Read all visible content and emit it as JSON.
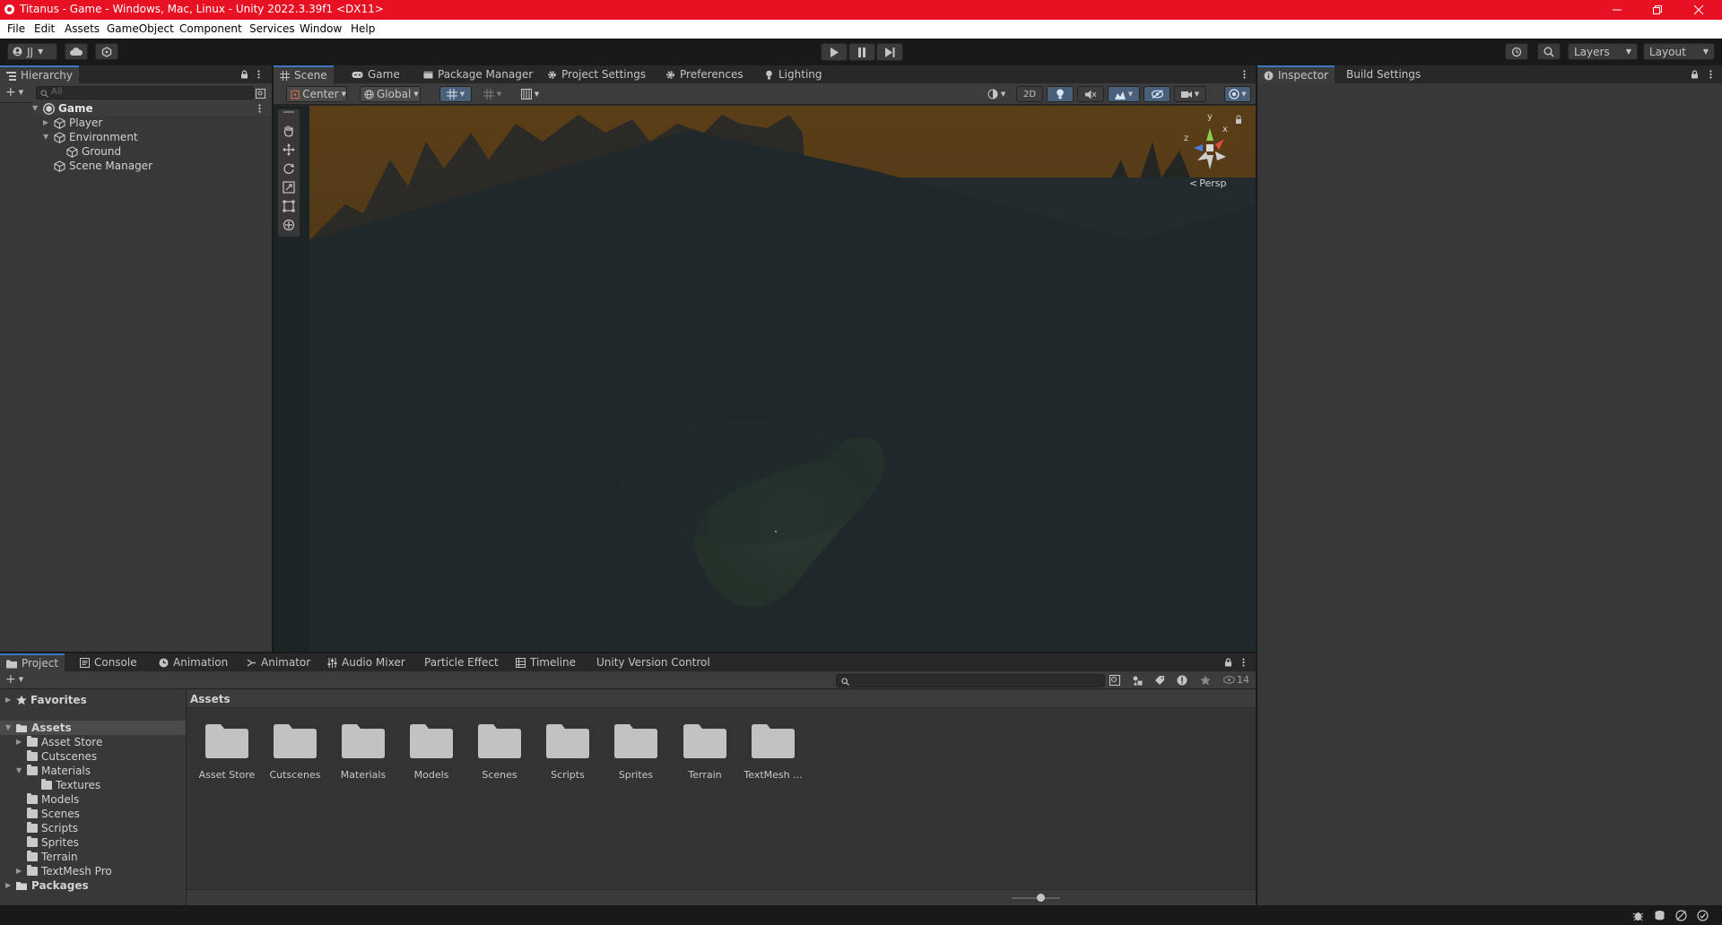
{
  "window": {
    "title": "Titanus - Game - Windows, Mac, Linux - Unity 2022.3.39f1 <DX11>"
  },
  "menu": [
    "File",
    "Edit",
    "Assets",
    "GameObject",
    "Component",
    "Services",
    "Window",
    "Help"
  ],
  "toolbar": {
    "account_label": "JJ",
    "layers_label": "Layers",
    "layout_label": "Layout"
  },
  "hierarchy": {
    "tab_label": "Hierarchy",
    "search_placeholder": "All",
    "scene_name": "Game",
    "items": [
      {
        "label": "Player"
      },
      {
        "label": "Environment"
      },
      {
        "label": "Ground"
      },
      {
        "label": "Scene Manager"
      }
    ]
  },
  "center_tabs": [
    "Scene",
    "Game",
    "Package Manager",
    "Project Settings",
    "Preferences",
    "Lighting"
  ],
  "scene_toolbar": {
    "pivot_label": "Center",
    "space_label": "Global",
    "mode_2d_label": "2D"
  },
  "gizmo": {
    "axis_y": "y",
    "axis_x": "x",
    "axis_z": "z",
    "projection_label": "Persp"
  },
  "right_tabs": [
    "Inspector",
    "Build Settings"
  ],
  "bottom_tabs": [
    "Project",
    "Console",
    "Animation",
    "Animator",
    "Audio Mixer",
    "Particle Effect",
    "Timeline",
    "Unity Version Control"
  ],
  "project": {
    "favorites_label": "Favorites",
    "assets_label": "Assets",
    "packages_label": "Packages",
    "tree": [
      {
        "label": "Asset Store"
      },
      {
        "label": "Cutscenes"
      },
      {
        "label": "Materials"
      },
      {
        "label": "Textures"
      },
      {
        "label": "Models"
      },
      {
        "label": "Scenes"
      },
      {
        "label": "Scripts"
      },
      {
        "label": "Sprites"
      },
      {
        "label": "Terrain"
      },
      {
        "label": "TextMesh Pro"
      }
    ],
    "breadcrumb": "Assets",
    "hidden_count": "14",
    "folders": [
      {
        "label": "Asset Store"
      },
      {
        "label": "Cutscenes"
      },
      {
        "label": "Materials"
      },
      {
        "label": "Models"
      },
      {
        "label": "Scenes"
      },
      {
        "label": "Scripts"
      },
      {
        "label": "Sprites"
      },
      {
        "label": "Terrain"
      },
      {
        "label": "TextMesh ..."
      }
    ]
  },
  "colors": {
    "titlebar": "#e81123",
    "accent": "#3a79bb",
    "sky": "#4a3416",
    "ground": "#1c2528"
  }
}
